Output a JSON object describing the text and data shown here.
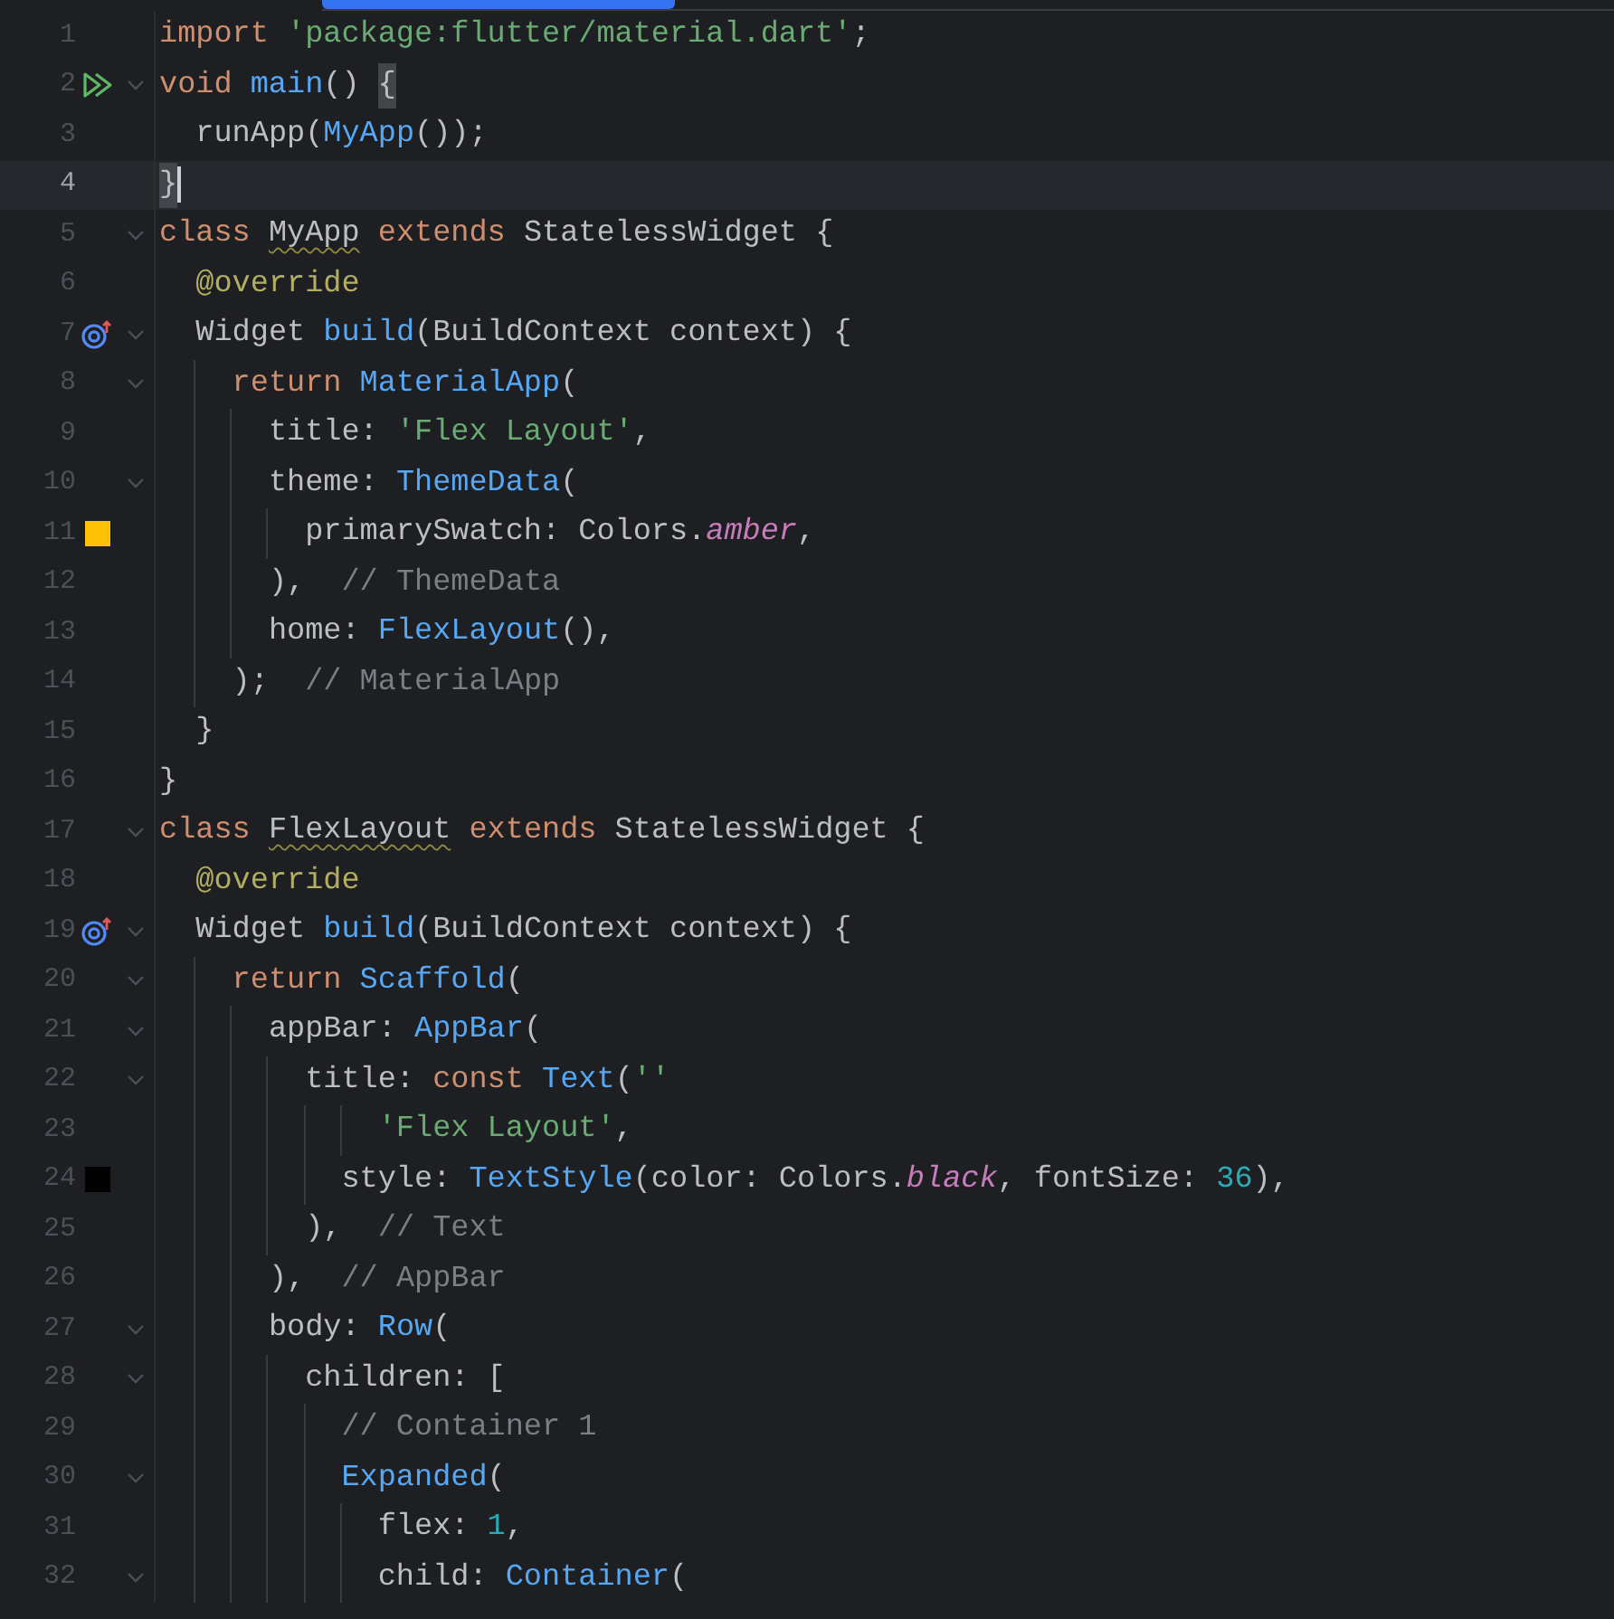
{
  "editor": {
    "lines": [
      {
        "number": "1",
        "fold": false,
        "current": false,
        "tokens": [
          {
            "kind": "keyword",
            "text": "import "
          },
          {
            "kind": "string",
            "text": "'package:flutter/material.dart'"
          },
          {
            "kind": "plain",
            "text": ";"
          }
        ]
      },
      {
        "number": "2",
        "fold": true,
        "current": false,
        "marker": {
          "kind": "run"
        },
        "tokens": [
          {
            "kind": "keyword",
            "text": "void "
          },
          {
            "kind": "function",
            "text": "main"
          },
          {
            "kind": "plain",
            "text": "() "
          },
          {
            "kind": "brace",
            "text": "{"
          }
        ]
      },
      {
        "number": "3",
        "fold": false,
        "current": false,
        "tokens": [
          {
            "kind": "plain",
            "text": "  runApp("
          },
          {
            "kind": "function",
            "text": "MyApp"
          },
          {
            "kind": "plain",
            "text": "());"
          }
        ]
      },
      {
        "number": "4",
        "fold": false,
        "current": true,
        "tokens": [
          {
            "kind": "brace",
            "text": "}"
          }
        ]
      },
      {
        "number": "5",
        "fold": true,
        "current": false,
        "tokens": [
          {
            "kind": "keyword",
            "text": "class "
          },
          {
            "kind": "declaration",
            "text": "MyApp"
          },
          {
            "kind": "keyword",
            "text": " extends "
          },
          {
            "kind": "plain",
            "text": "StatelessWidget {"
          }
        ]
      },
      {
        "number": "6",
        "fold": false,
        "current": false,
        "tokens": [
          {
            "kind": "annotation",
            "text": "  @override"
          }
        ]
      },
      {
        "number": "7",
        "fold": true,
        "current": false,
        "marker": {
          "kind": "override"
        },
        "tokens": [
          {
            "kind": "plain",
            "text": "  Widget "
          },
          {
            "kind": "function",
            "text": "build"
          },
          {
            "kind": "plain",
            "text": "(BuildContext context) {"
          }
        ]
      },
      {
        "number": "8",
        "fold": true,
        "current": false,
        "tokens": [
          {
            "kind": "keyword",
            "text": "    return "
          },
          {
            "kind": "function",
            "text": "MaterialApp"
          },
          {
            "kind": "plain",
            "text": "("
          }
        ]
      },
      {
        "number": "9",
        "fold": false,
        "current": false,
        "tokens": [
          {
            "kind": "plain",
            "text": "      title: "
          },
          {
            "kind": "string",
            "text": "'Flex Layout'"
          },
          {
            "kind": "plain",
            "text": ","
          }
        ]
      },
      {
        "number": "10",
        "fold": true,
        "current": false,
        "tokens": [
          {
            "kind": "plain",
            "text": "      theme: "
          },
          {
            "kind": "function",
            "text": "ThemeData"
          },
          {
            "kind": "plain",
            "text": "("
          }
        ]
      },
      {
        "number": "11",
        "fold": false,
        "current": false,
        "marker": {
          "kind": "swatch",
          "color": "#ffc107"
        },
        "tokens": [
          {
            "kind": "plain",
            "text": "        primarySwatch: Colors."
          },
          {
            "kind": "constant",
            "text": "amber"
          },
          {
            "kind": "plain",
            "text": ","
          }
        ]
      },
      {
        "number": "12",
        "fold": false,
        "current": false,
        "tokens": [
          {
            "kind": "plain",
            "text": "      ),  "
          },
          {
            "kind": "comment",
            "text": "// ThemeData"
          }
        ]
      },
      {
        "number": "13",
        "fold": false,
        "current": false,
        "tokens": [
          {
            "kind": "plain",
            "text": "      home: "
          },
          {
            "kind": "function",
            "text": "FlexLayout"
          },
          {
            "kind": "plain",
            "text": "(),"
          }
        ]
      },
      {
        "number": "14",
        "fold": false,
        "current": false,
        "tokens": [
          {
            "kind": "plain",
            "text": "    );  "
          },
          {
            "kind": "comment",
            "text": "// MaterialApp"
          }
        ]
      },
      {
        "number": "15",
        "fold": false,
        "current": false,
        "tokens": [
          {
            "kind": "plain",
            "text": "  }"
          }
        ]
      },
      {
        "number": "16",
        "fold": false,
        "current": false,
        "tokens": [
          {
            "kind": "plain",
            "text": "}"
          }
        ]
      },
      {
        "number": "17",
        "fold": true,
        "current": false,
        "tokens": [
          {
            "kind": "keyword",
            "text": "class "
          },
          {
            "kind": "declaration",
            "text": "FlexLayout"
          },
          {
            "kind": "keyword",
            "text": " extends "
          },
          {
            "kind": "plain",
            "text": "StatelessWidget {"
          }
        ]
      },
      {
        "number": "18",
        "fold": false,
        "current": false,
        "tokens": [
          {
            "kind": "annotation",
            "text": "  @override"
          }
        ]
      },
      {
        "number": "19",
        "fold": true,
        "current": false,
        "marker": {
          "kind": "override"
        },
        "tokens": [
          {
            "kind": "plain",
            "text": "  Widget "
          },
          {
            "kind": "function",
            "text": "build"
          },
          {
            "kind": "plain",
            "text": "(BuildContext context) {"
          }
        ]
      },
      {
        "number": "20",
        "fold": true,
        "current": false,
        "tokens": [
          {
            "kind": "keyword",
            "text": "    return "
          },
          {
            "kind": "function",
            "text": "Scaffold"
          },
          {
            "kind": "plain",
            "text": "("
          }
        ]
      },
      {
        "number": "21",
        "fold": true,
        "current": false,
        "tokens": [
          {
            "kind": "plain",
            "text": "      appBar: "
          },
          {
            "kind": "function",
            "text": "AppBar"
          },
          {
            "kind": "plain",
            "text": "("
          }
        ]
      },
      {
        "number": "22",
        "fold": true,
        "current": false,
        "tokens": [
          {
            "kind": "plain",
            "text": "        title: "
          },
          {
            "kind": "keyword",
            "text": "const "
          },
          {
            "kind": "function",
            "text": "Text"
          },
          {
            "kind": "plain",
            "text": "("
          },
          {
            "kind": "string",
            "text": "''"
          }
        ]
      },
      {
        "number": "23",
        "fold": false,
        "current": false,
        "tokens": [
          {
            "kind": "string",
            "text": "            'Flex Layout'"
          },
          {
            "kind": "plain",
            "text": ","
          }
        ]
      },
      {
        "number": "24",
        "fold": false,
        "current": false,
        "marker": {
          "kind": "swatch",
          "color": "#000000"
        },
        "tokens": [
          {
            "kind": "plain",
            "text": "          style: "
          },
          {
            "kind": "function",
            "text": "TextStyle"
          },
          {
            "kind": "plain",
            "text": "(color: Colors."
          },
          {
            "kind": "constant",
            "text": "black"
          },
          {
            "kind": "plain",
            "text": ", fontSize: "
          },
          {
            "kind": "number",
            "text": "36"
          },
          {
            "kind": "plain",
            "text": "),"
          }
        ]
      },
      {
        "number": "25",
        "fold": false,
        "current": false,
        "tokens": [
          {
            "kind": "plain",
            "text": "        ),  "
          },
          {
            "kind": "comment",
            "text": "// Text"
          }
        ]
      },
      {
        "number": "26",
        "fold": false,
        "current": false,
        "tokens": [
          {
            "kind": "plain",
            "text": "      ),  "
          },
          {
            "kind": "comment",
            "text": "// AppBar"
          }
        ]
      },
      {
        "number": "27",
        "fold": true,
        "current": false,
        "tokens": [
          {
            "kind": "plain",
            "text": "      body: "
          },
          {
            "kind": "function",
            "text": "Row"
          },
          {
            "kind": "plain",
            "text": "("
          }
        ]
      },
      {
        "number": "28",
        "fold": true,
        "current": false,
        "tokens": [
          {
            "kind": "plain",
            "text": "        children: ["
          }
        ]
      },
      {
        "number": "29",
        "fold": false,
        "current": false,
        "tokens": [
          {
            "kind": "comment",
            "text": "          // Container 1"
          }
        ]
      },
      {
        "number": "30",
        "fold": true,
        "current": false,
        "tokens": [
          {
            "kind": "function",
            "text": "          Expanded"
          },
          {
            "kind": "plain",
            "text": "("
          }
        ]
      },
      {
        "number": "31",
        "fold": false,
        "current": false,
        "tokens": [
          {
            "kind": "plain",
            "text": "            flex: "
          },
          {
            "kind": "number",
            "text": "1"
          },
          {
            "kind": "plain",
            "text": ","
          }
        ]
      },
      {
        "number": "32",
        "fold": true,
        "current": false,
        "tokens": [
          {
            "kind": "plain",
            "text": "            child: "
          },
          {
            "kind": "function",
            "text": "Container"
          },
          {
            "kind": "plain",
            "text": "("
          }
        ]
      }
    ]
  }
}
